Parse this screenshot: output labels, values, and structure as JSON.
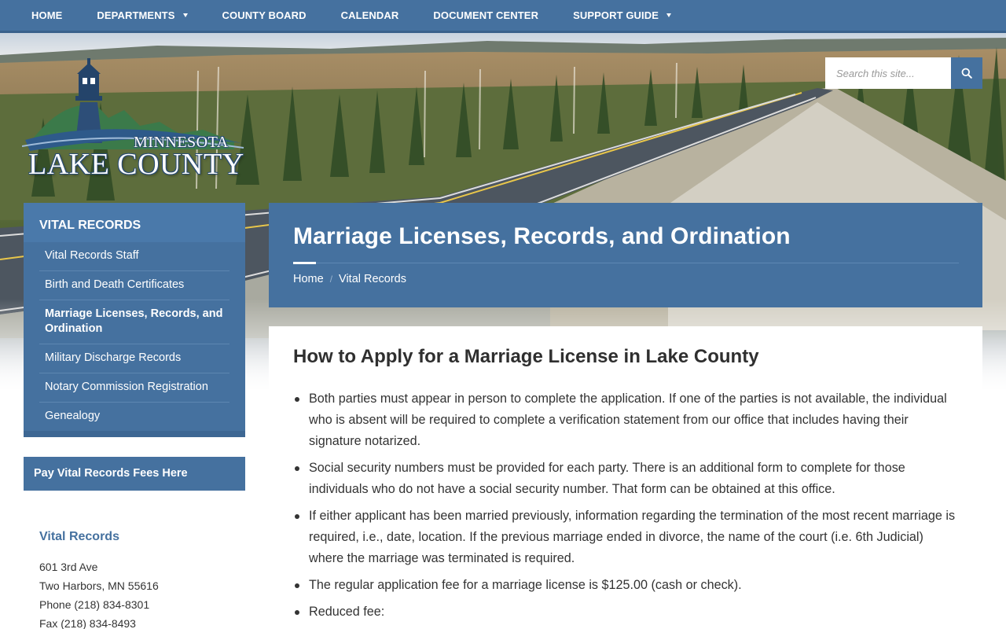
{
  "nav": {
    "items": [
      {
        "label": "HOME",
        "dropdown": false
      },
      {
        "label": "DEPARTMENTS",
        "dropdown": true
      },
      {
        "label": "COUNTY BOARD",
        "dropdown": false
      },
      {
        "label": "CALENDAR",
        "dropdown": false
      },
      {
        "label": "DOCUMENT CENTER",
        "dropdown": false
      },
      {
        "label": "SUPPORT GUIDE",
        "dropdown": true
      }
    ]
  },
  "search": {
    "placeholder": "Search this site...",
    "icon": "search-icon"
  },
  "logo": {
    "subtitle": "MINNESOTA",
    "name": "LAKE COUNTY"
  },
  "sidebar": {
    "title": "VITAL RECORDS",
    "items": [
      {
        "label": "Vital Records Staff",
        "active": false
      },
      {
        "label": "Birth and Death Certificates",
        "active": false
      },
      {
        "label": "Marriage Licenses, Records, and Ordination",
        "active": true
      },
      {
        "label": "Military Discharge Records",
        "active": false
      },
      {
        "label": "Notary Commission Registration",
        "active": false
      },
      {
        "label": "Genealogy",
        "active": false
      }
    ],
    "pay_button": "Pay Vital Records Fees Here",
    "contact": {
      "title": "Vital Records",
      "address1": "601 3rd Ave",
      "address2": "Two Harbors, MN 55616",
      "phone": "Phone (218) 834-8301",
      "fax": "Fax (218) 834-8493"
    }
  },
  "page": {
    "title": "Marriage Licenses, Records, and Ordination",
    "breadcrumb": {
      "home": "Home",
      "separator": "/",
      "current": "Vital Records"
    }
  },
  "content": {
    "heading": "How to Apply for a Marriage License in Lake County",
    "bullets": [
      "Both parties must appear in person to complete the application. If one of the parties is not available, the individual who is absent will be required to complete a verification statement from our office that includes having their signature notarized.",
      "Social security numbers must be provided for each party. There is an additional form to complete for those individuals who do not have a social security number. That form can be obtained at this office.",
      "If either applicant has been married previously, information regarding the termination of the most recent marriage is required, i.e., date, location. If the previous marriage ended in divorce, the name of the court (i.e. 6th Judicial) where the marriage was terminated is required.",
      "The regular application fee for a marriage license is $125.00 (cash or check).",
      "Reduced fee:"
    ]
  },
  "colors": {
    "brand_blue": "#45719f",
    "nav_blue": "#45719f",
    "accent_white": "#ffffff"
  }
}
